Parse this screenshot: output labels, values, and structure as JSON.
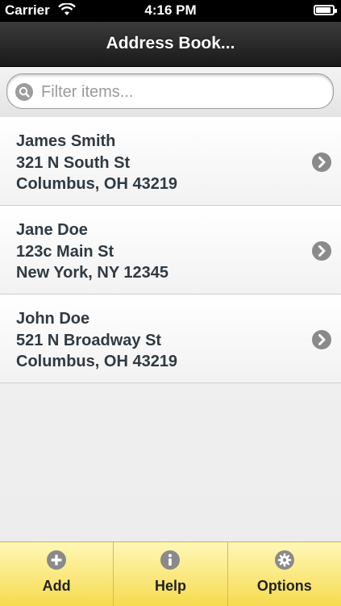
{
  "status_bar": {
    "carrier": "Carrier",
    "time": "4:16 PM",
    "battery_level": 0.9
  },
  "nav": {
    "title": "Address Book..."
  },
  "search": {
    "placeholder": "Filter items..."
  },
  "contacts": [
    {
      "name": "James Smith",
      "street": "321 N South St",
      "city": "Columbus, OH 43219"
    },
    {
      "name": "Jane Doe",
      "street": "123c Main St",
      "city": "New York, NY 12345"
    },
    {
      "name": "John Doe",
      "street": "521 N Broadway St",
      "city": "Columbus, OH 43219"
    }
  ],
  "tabs": [
    {
      "label": "Add",
      "icon": "plus-circle-icon"
    },
    {
      "label": "Help",
      "icon": "info-circle-icon"
    },
    {
      "label": "Options",
      "icon": "gear-icon"
    }
  ],
  "colors": {
    "accent": "#f6db4e",
    "icon": "#8a8a8a"
  }
}
